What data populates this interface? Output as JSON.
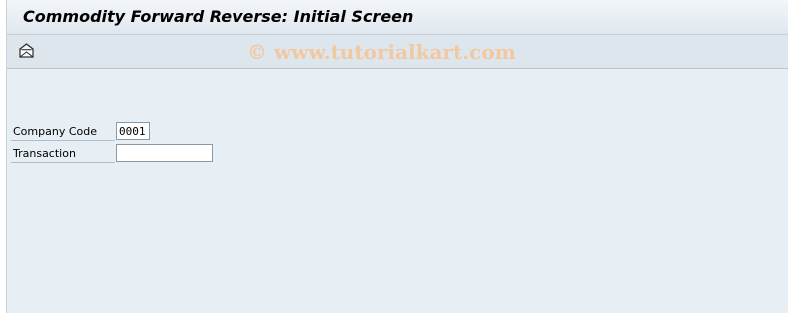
{
  "window": {
    "title": "Commodity Forward Reverse: Initial Screen"
  },
  "toolbar": {
    "execute_icon": "execute-icon",
    "watermark": "© www.tutorialkart.com"
  },
  "form": {
    "company_code": {
      "label": "Company Code",
      "value": "0001"
    },
    "transaction": {
      "label": "Transaction",
      "value": ""
    }
  }
}
